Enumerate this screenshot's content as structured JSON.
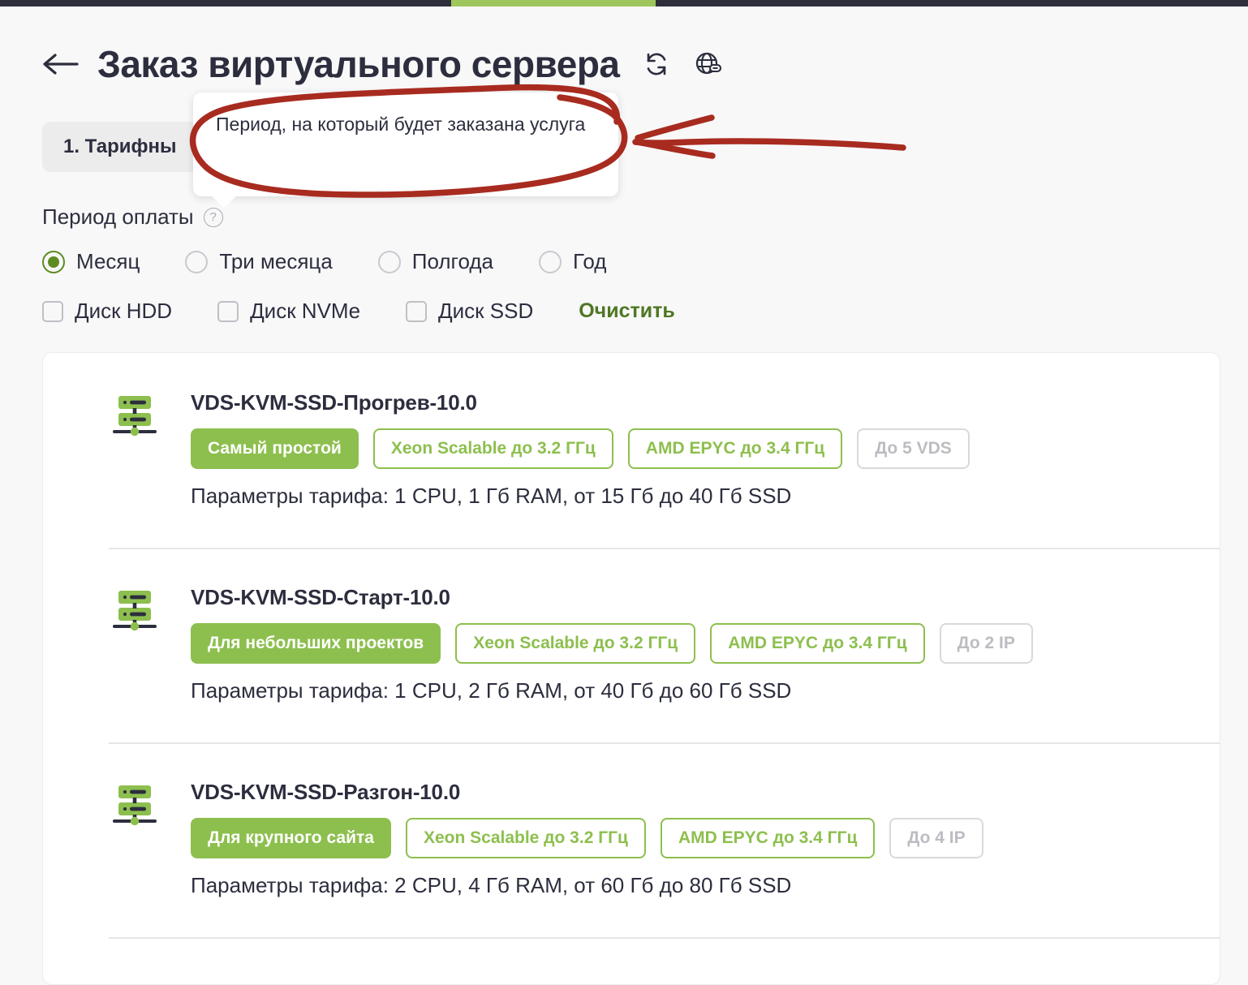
{
  "top_strip": {
    "background_color": "#2d2f3d",
    "active_color": "#9fc65c"
  },
  "header": {
    "back_icon": "arrow-left-icon",
    "title": "Заказ виртуального сервера",
    "refresh_icon": "refresh-icon",
    "globe_link_icon": "globe-link-icon"
  },
  "steps": {
    "current": "1. Тарифны"
  },
  "tooltip": {
    "text": "Период, на который будет заказана услуга"
  },
  "filters": {
    "pay_period_label": "Период оплаты",
    "help_icon_text": "?",
    "periods": [
      {
        "label": "Месяц",
        "selected": true
      },
      {
        "label": "Три месяца",
        "selected": false
      },
      {
        "label": "Полгода",
        "selected": false
      },
      {
        "label": "Год",
        "selected": false
      }
    ],
    "disk_filters": [
      {
        "label": "Диск HDD",
        "checked": false
      },
      {
        "label": "Диск NVMe",
        "checked": false
      },
      {
        "label": "Диск SSD",
        "checked": false
      }
    ],
    "clear_label": "Очистить"
  },
  "colors": {
    "accent_green": "#8dbf4e",
    "link_green": "#4f7723",
    "radio_green": "#5d8b1f",
    "text_dark": "#2c2e3e",
    "annotation_red": "#a82b20",
    "page_bg": "#f8f8f9"
  },
  "tariffs": [
    {
      "icon": "server-icon",
      "name": "VDS-KVM-SSD-Прогрев-10.0",
      "badges": [
        {
          "label": "Самый простой",
          "style": "solid"
        },
        {
          "label": "Xeon Scalable до 3.2 ГГц",
          "style": "outline"
        },
        {
          "label": "AMD EPYC до 3.4 ГГц",
          "style": "outline"
        },
        {
          "label": "До 5 VDS",
          "style": "muted"
        }
      ],
      "params": "Параметры тарифа: 1 CPU, 1 Гб RAM, от 15 Гб до 40 Гб SSD"
    },
    {
      "icon": "server-icon",
      "name": "VDS-KVM-SSD-Старт-10.0",
      "badges": [
        {
          "label": "Для небольших проектов",
          "style": "solid"
        },
        {
          "label": "Xeon Scalable до 3.2 ГГц",
          "style": "outline"
        },
        {
          "label": "AMD EPYC до 3.4 ГГц",
          "style": "outline"
        },
        {
          "label": "До 2 IP",
          "style": "muted"
        }
      ],
      "params": "Параметры тарифа: 1 CPU, 2 Гб RAM, от 40 Гб до 60 Гб SSD"
    },
    {
      "icon": "server-icon",
      "name": "VDS-KVM-SSD-Разгон-10.0",
      "badges": [
        {
          "label": "Для крупного сайта",
          "style": "solid"
        },
        {
          "label": "Xeon Scalable до 3.2 ГГц",
          "style": "outline"
        },
        {
          "label": "AMD EPYC до 3.4 ГГц",
          "style": "outline"
        },
        {
          "label": "До 4 IP",
          "style": "muted"
        }
      ],
      "params": "Параметры тарифа: 2 CPU, 4 Гб RAM, от 60 Гб до 80 Гб SSD"
    }
  ],
  "annotation": {
    "type": "hand-drawn-markup",
    "shapes": [
      "ellipse-around-tooltip",
      "arrow-pointing-left"
    ],
    "color": "#a82b20"
  }
}
